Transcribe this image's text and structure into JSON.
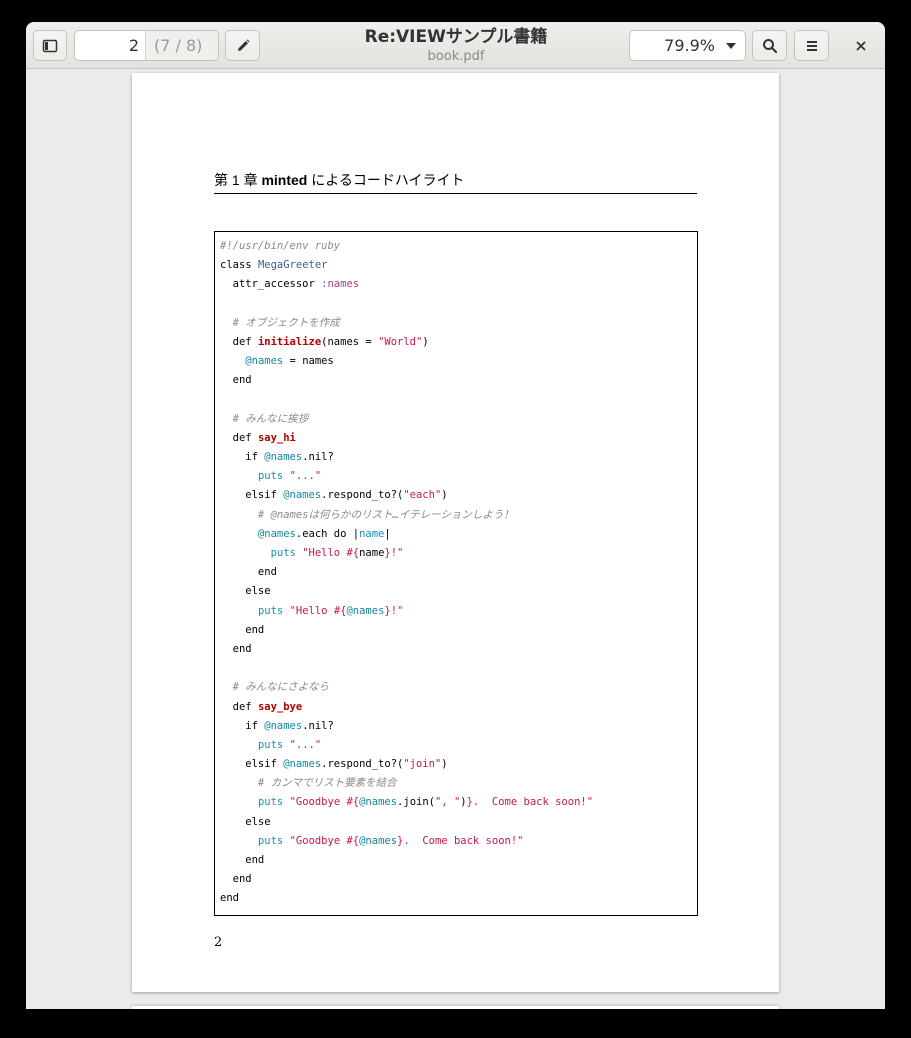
{
  "header": {
    "title": "Re:VIEWサンプル書籍",
    "subtitle": "book.pdf",
    "page_current": "2",
    "page_total": "(7 / 8)",
    "zoom": "79.9%"
  },
  "icons": {
    "sidebar": "sidebar-toggle-icon",
    "edit": "pencil-icon",
    "search": "search-icon",
    "menu": "hamburger-menu-icon",
    "close": "close-icon"
  },
  "document": {
    "chapter_prefix": "第 1 章 ",
    "chapter_bold": "minted",
    "chapter_suffix": " によるコードハイライト",
    "page_number": "2",
    "code_lines": [
      [
        {
          "t": "#!/usr/bin/env ruby",
          "c": "comment"
        }
      ],
      [
        {
          "t": "class ",
          "c": ""
        },
        {
          "t": "MegaGreeter",
          "c": "const"
        }
      ],
      [
        {
          "t": "  attr_accessor ",
          "c": ""
        },
        {
          "t": ":names",
          "c": "sym"
        }
      ],
      [
        {
          "t": "",
          "c": ""
        }
      ],
      [
        {
          "t": "  # オブジェクトを作成",
          "c": "comment"
        }
      ],
      [
        {
          "t": "  def ",
          "c": ""
        },
        {
          "t": "initialize",
          "c": "def"
        },
        {
          "t": "(names = ",
          "c": ""
        },
        {
          "t": "\"World\"",
          "c": "str"
        },
        {
          "t": ")",
          "c": ""
        }
      ],
      [
        {
          "t": "    ",
          "c": ""
        },
        {
          "t": "@names",
          "c": "ivar"
        },
        {
          "t": " = names",
          "c": ""
        }
      ],
      [
        {
          "t": "  end",
          "c": ""
        }
      ],
      [
        {
          "t": "",
          "c": ""
        }
      ],
      [
        {
          "t": "  # みんなに挨拶",
          "c": "comment"
        }
      ],
      [
        {
          "t": "  def ",
          "c": ""
        },
        {
          "t": "say_hi",
          "c": "def"
        }
      ],
      [
        {
          "t": "    if ",
          "c": ""
        },
        {
          "t": "@names",
          "c": "ivar"
        },
        {
          "t": ".nil?",
          "c": ""
        }
      ],
      [
        {
          "t": "      ",
          "c": ""
        },
        {
          "t": "puts",
          "c": "builtin"
        },
        {
          "t": " ",
          "c": ""
        },
        {
          "t": "\"...\"",
          "c": "str"
        }
      ],
      [
        {
          "t": "    elsif ",
          "c": ""
        },
        {
          "t": "@names",
          "c": "ivar"
        },
        {
          "t": ".respond_to?(",
          "c": ""
        },
        {
          "t": "\"each\"",
          "c": "str"
        },
        {
          "t": ")",
          "c": ""
        }
      ],
      [
        {
          "t": "      # @namesは何らかのリスト…イテレーションしよう！",
          "c": "comment"
        }
      ],
      [
        {
          "t": "      ",
          "c": ""
        },
        {
          "t": "@names",
          "c": "ivar"
        },
        {
          "t": ".each do |",
          "c": ""
        },
        {
          "t": "name",
          "c": "builtin"
        },
        {
          "t": "|",
          "c": ""
        }
      ],
      [
        {
          "t": "        ",
          "c": ""
        },
        {
          "t": "puts",
          "c": "builtin"
        },
        {
          "t": " ",
          "c": ""
        },
        {
          "t": "\"Hello #{",
          "c": "str"
        },
        {
          "t": "name",
          "c": ""
        },
        {
          "t": "}!\"",
          "c": "str"
        }
      ],
      [
        {
          "t": "      end",
          "c": ""
        }
      ],
      [
        {
          "t": "    else",
          "c": ""
        }
      ],
      [
        {
          "t": "      ",
          "c": ""
        },
        {
          "t": "puts",
          "c": "builtin"
        },
        {
          "t": " ",
          "c": ""
        },
        {
          "t": "\"Hello #{",
          "c": "str"
        },
        {
          "t": "@names",
          "c": "ivar"
        },
        {
          "t": "}!\"",
          "c": "str"
        }
      ],
      [
        {
          "t": "    end",
          "c": ""
        }
      ],
      [
        {
          "t": "  end",
          "c": ""
        }
      ],
      [
        {
          "t": "",
          "c": ""
        }
      ],
      [
        {
          "t": "  # みんなにさよなら",
          "c": "comment"
        }
      ],
      [
        {
          "t": "  def ",
          "c": ""
        },
        {
          "t": "say_bye",
          "c": "def"
        }
      ],
      [
        {
          "t": "    if ",
          "c": ""
        },
        {
          "t": "@names",
          "c": "ivar"
        },
        {
          "t": ".nil?",
          "c": ""
        }
      ],
      [
        {
          "t": "      ",
          "c": ""
        },
        {
          "t": "puts",
          "c": "builtin"
        },
        {
          "t": " ",
          "c": ""
        },
        {
          "t": "\"...\"",
          "c": "str"
        }
      ],
      [
        {
          "t": "    elsif ",
          "c": ""
        },
        {
          "t": "@names",
          "c": "ivar"
        },
        {
          "t": ".respond_to?(",
          "c": ""
        },
        {
          "t": "\"join\"",
          "c": "str"
        },
        {
          "t": ")",
          "c": ""
        }
      ],
      [
        {
          "t": "      # カンマでリスト要素を結合",
          "c": "comment"
        }
      ],
      [
        {
          "t": "      ",
          "c": ""
        },
        {
          "t": "puts",
          "c": "builtin"
        },
        {
          "t": " ",
          "c": ""
        },
        {
          "t": "\"Goodbye #{",
          "c": "str"
        },
        {
          "t": "@names",
          "c": "ivar"
        },
        {
          "t": ".join(",
          "c": ""
        },
        {
          "t": "\", \"",
          "c": "str"
        },
        {
          "t": ")",
          "c": ""
        },
        {
          "t": "}.  Come back soon!\"",
          "c": "str"
        }
      ],
      [
        {
          "t": "    else",
          "c": ""
        }
      ],
      [
        {
          "t": "      ",
          "c": ""
        },
        {
          "t": "puts",
          "c": "builtin"
        },
        {
          "t": " ",
          "c": ""
        },
        {
          "t": "\"Goodbye #{",
          "c": "str"
        },
        {
          "t": "@names",
          "c": "ivar"
        },
        {
          "t": "}.  Come back soon!\"",
          "c": "str"
        }
      ],
      [
        {
          "t": "    end",
          "c": ""
        }
      ],
      [
        {
          "t": "  end",
          "c": ""
        }
      ],
      [
        {
          "t": "end",
          "c": ""
        }
      ]
    ]
  }
}
